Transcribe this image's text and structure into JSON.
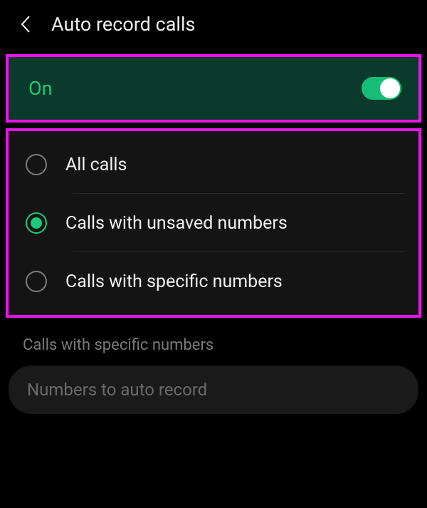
{
  "header": {
    "title": "Auto record calls"
  },
  "toggle": {
    "label": "On",
    "state": true
  },
  "options": [
    {
      "label": "All calls",
      "selected": false
    },
    {
      "label": "Calls with unsaved numbers",
      "selected": true
    },
    {
      "label": "Calls with specific numbers",
      "selected": false
    }
  ],
  "specific": {
    "section_label": "Calls with specific numbers",
    "input_placeholder": "Numbers to auto record"
  }
}
